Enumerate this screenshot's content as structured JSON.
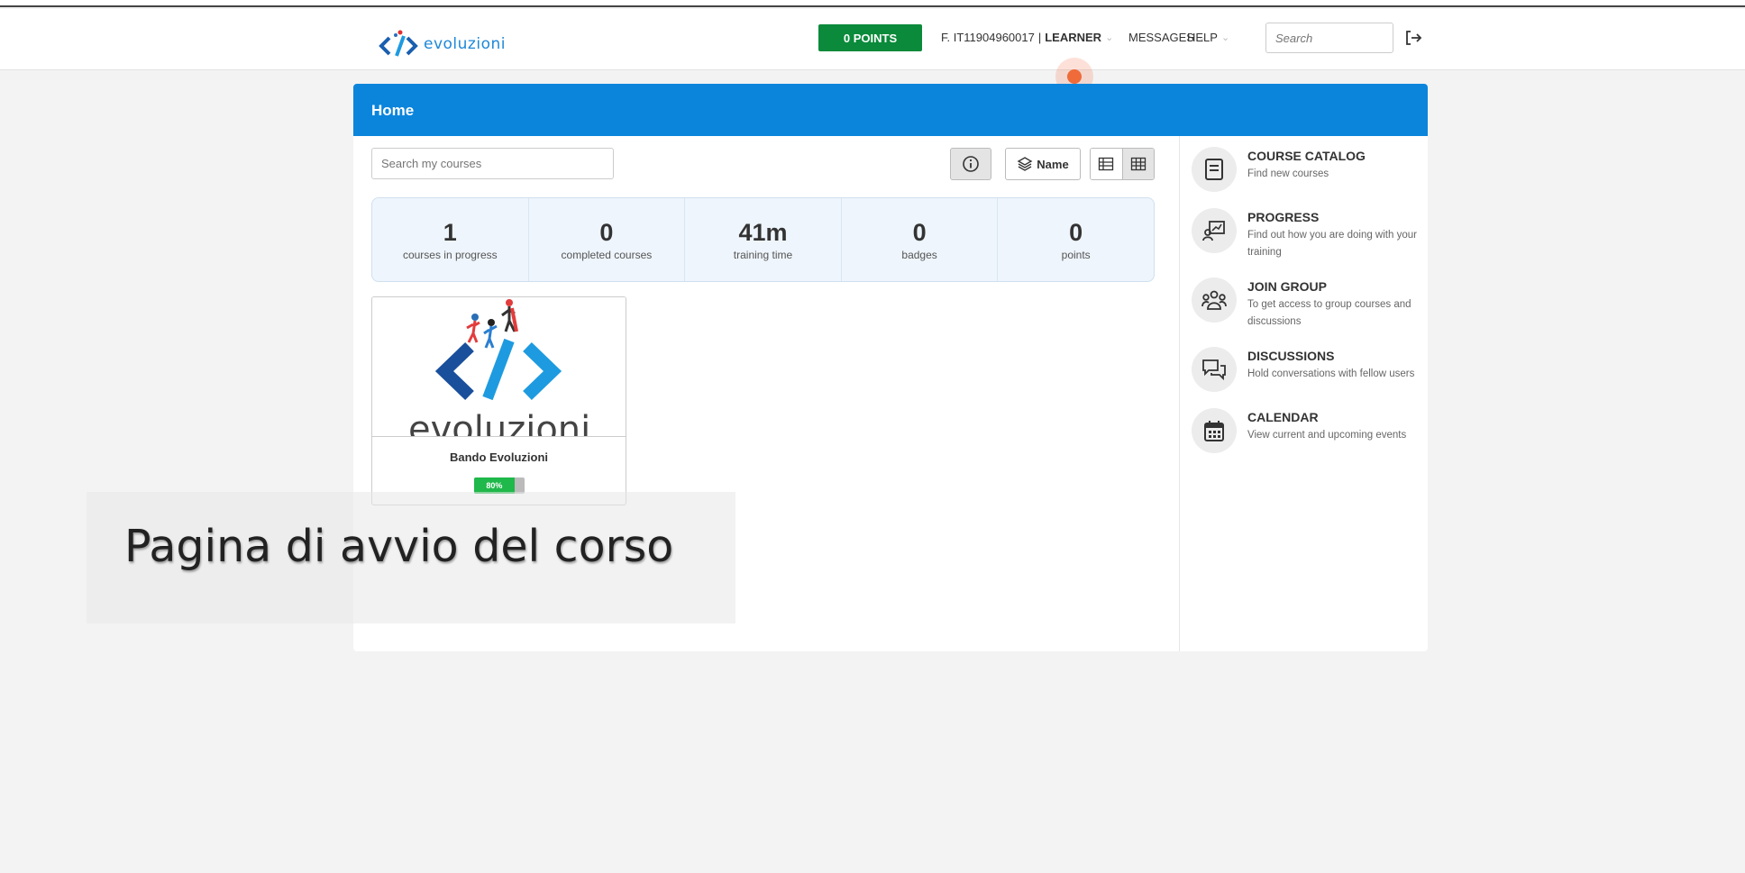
{
  "header": {
    "logo_text": "evoluzioni",
    "points_label": "0 POINTS",
    "user_id": "F. IT11904960017",
    "separator": "|",
    "role": "LEARNER",
    "messages_label": "MESSAGES",
    "help_label": "HELP",
    "search_placeholder": "Search"
  },
  "main": {
    "title": "Home",
    "search_placeholder": "Search my courses",
    "sort_label": "Name",
    "stats": [
      {
        "value": "1",
        "label": "courses in progress"
      },
      {
        "value": "0",
        "label": "completed courses"
      },
      {
        "value": "41m",
        "label": "training time"
      },
      {
        "value": "0",
        "label": "badges"
      },
      {
        "value": "0",
        "label": "points"
      }
    ],
    "course": {
      "image_text": "evoluzioni",
      "title": "Bando Evoluzioni",
      "progress_label": "80%",
      "progress_fraction": 0.8
    }
  },
  "sidebar": {
    "items": [
      {
        "title": "COURSE CATALOG",
        "desc": "Find new courses",
        "icon": "book-icon"
      },
      {
        "title": "PROGRESS",
        "desc": "Find out how you are doing with your training",
        "icon": "progress-chart-icon"
      },
      {
        "title": "JOIN GROUP",
        "desc": "To get access to group courses and discussions",
        "icon": "group-icon"
      },
      {
        "title": "DISCUSSIONS",
        "desc": "Hold conversations with fellow users",
        "icon": "chat-bubbles-icon"
      },
      {
        "title": "CALENDAR",
        "desc": "View current and upcoming events",
        "icon": "calendar-icon"
      }
    ]
  },
  "caption": "Pagina di avvio del corso",
  "colors": {
    "header_blue": "#0b85dc",
    "points_green": "#0a8a3a",
    "progress_green": "#1fb84a",
    "cursor_orange": "#ef6b3a"
  }
}
